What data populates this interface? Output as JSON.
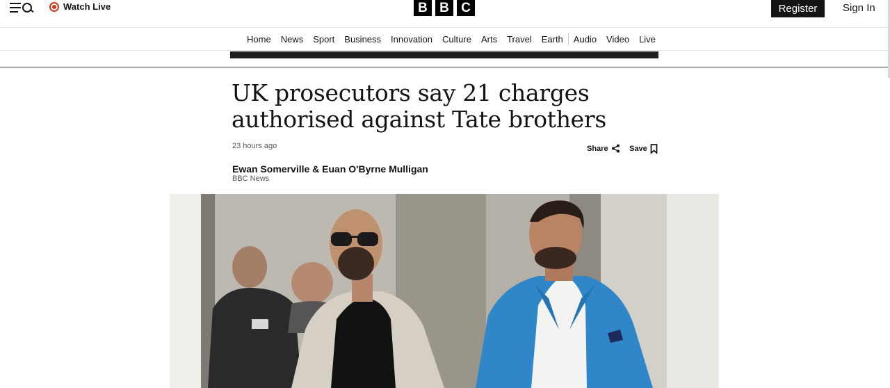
{
  "header": {
    "watch_live": "Watch Live",
    "logo_letters": [
      "B",
      "B",
      "C"
    ],
    "register": "Register",
    "sign_in": "Sign In",
    "live_color": "#d4351c"
  },
  "nav": {
    "items": [
      "Home",
      "News",
      "Sport",
      "Business",
      "Innovation",
      "Culture",
      "Arts",
      "Travel",
      "Earth",
      "Audio",
      "Video",
      "Live"
    ]
  },
  "article": {
    "headline": "UK prosecutors say 21 charges authorised against Tate brothers",
    "timestamp": "23 hours ago",
    "share_label": "Share",
    "save_label": "Save",
    "authors": "Ewan Somerville & Euan O'Byrne Mulligan",
    "organisation": "BBC News"
  }
}
